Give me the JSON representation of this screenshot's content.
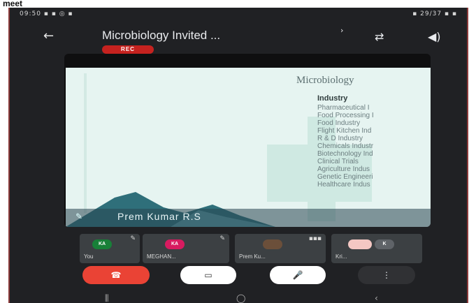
{
  "page_label": "meet",
  "status_bar": {
    "left": "09:50 ▪ ▪ ◎ ▪",
    "right": "▪ 29/37 ▪ ▪"
  },
  "header": {
    "back_icon": "back-arrow-icon",
    "title": "Microbiology Invited ...",
    "chevron": "›",
    "rec_badge": "REC",
    "icons": [
      "camera-switch-icon",
      "speaker-icon"
    ]
  },
  "slide": {
    "title": "Microbiology",
    "heading": "Industry",
    "items": [
      "Pharmaceutical I",
      "Food Processing I",
      "Food Industry",
      "Flight Kitchen Ind",
      "R & D Industry",
      "Chemicals Industr",
      "Biotechnology Ind",
      "Clinical Trials",
      "Agriculture Indus",
      "Genetic Engineeri",
      "Healthcare Indus"
    ],
    "presenter": "Prem Kumar R.S"
  },
  "participants": [
    {
      "initials": "KA",
      "name": "You",
      "color": "#188038"
    },
    {
      "initials": "KA",
      "name": "MEGHAN...",
      "color": "#d81b60"
    },
    {
      "initials": "",
      "name": "Prem Ku...",
      "color": "#6b4f3a"
    },
    {
      "initials": "K",
      "name": "Kri...",
      "color": "#5f6368"
    }
  ],
  "controls": {
    "end_label": "☎",
    "camera_label": "▭",
    "mic_label": "🎤",
    "more_label": "⋮"
  },
  "navbar": {
    "left": "⫼",
    "center": "◯",
    "right": "‹"
  }
}
